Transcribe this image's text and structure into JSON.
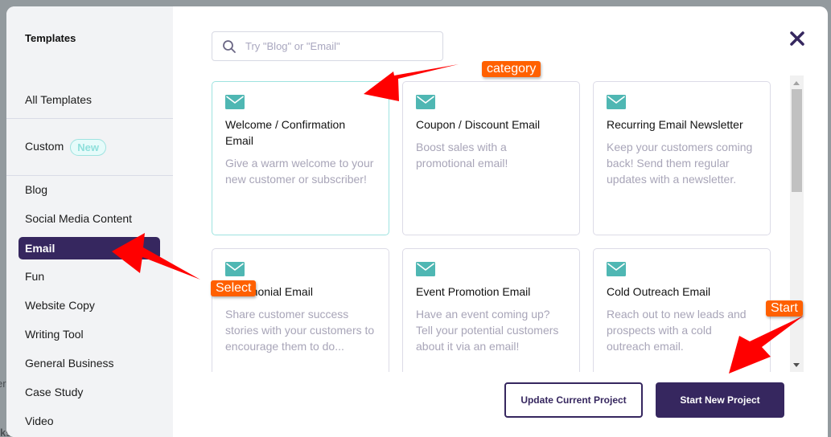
{
  "backdrop": {
    "partial_text_left": "er",
    "partial_text_bottom": "kspace"
  },
  "sidebar": {
    "title": "Templates",
    "items": [
      {
        "label": "All Templates"
      },
      {
        "label": "Custom",
        "badge": "New"
      },
      {
        "label": "Blog"
      },
      {
        "label": "Social Media Content"
      },
      {
        "label": "Email",
        "active": true
      },
      {
        "label": "Fun"
      },
      {
        "label": "Website Copy"
      },
      {
        "label": "Writing Tool"
      },
      {
        "label": "General Business"
      },
      {
        "label": "Case Study"
      },
      {
        "label": "Video"
      }
    ]
  },
  "search": {
    "placeholder": "Try \"Blog\" or \"Email\"",
    "value": ""
  },
  "close_icon": "close-icon",
  "cards": [
    {
      "icon": "mail-icon",
      "title": "Welcome / Confirmation Email",
      "description": "Give a warm welcome to your new customer or subscriber!"
    },
    {
      "icon": "mail-icon",
      "title": "Coupon / Discount Email",
      "description": "Boost sales with a promotional email!"
    },
    {
      "icon": "mail-icon",
      "title": "Recurring Email Newsletter",
      "description": "Keep your customers coming back! Send them regular updates with a newsletter."
    },
    {
      "icon": "mail-icon",
      "title": "Testimonial Email",
      "description": "Share customer success stories with your customers to encourage them to do..."
    },
    {
      "icon": "mail-icon",
      "title": "Event Promotion Email",
      "description": "Have an event coming up? Tell your potential customers about it via an email!"
    },
    {
      "icon": "mail-icon",
      "title": "Cold Outreach Email",
      "description": "Reach out to new leads and prospects with a cold outreach email."
    }
  ],
  "buttons": {
    "update": "Update Current Project",
    "start": "Start New Project"
  },
  "annotations": {
    "category": "category",
    "select": "Select",
    "start": "Start"
  },
  "colors": {
    "brand": "#36275f",
    "accent_teal": "#4fb7b3",
    "annotation_orange": "#ff6000",
    "annotation_arrow": "#ff0000"
  }
}
